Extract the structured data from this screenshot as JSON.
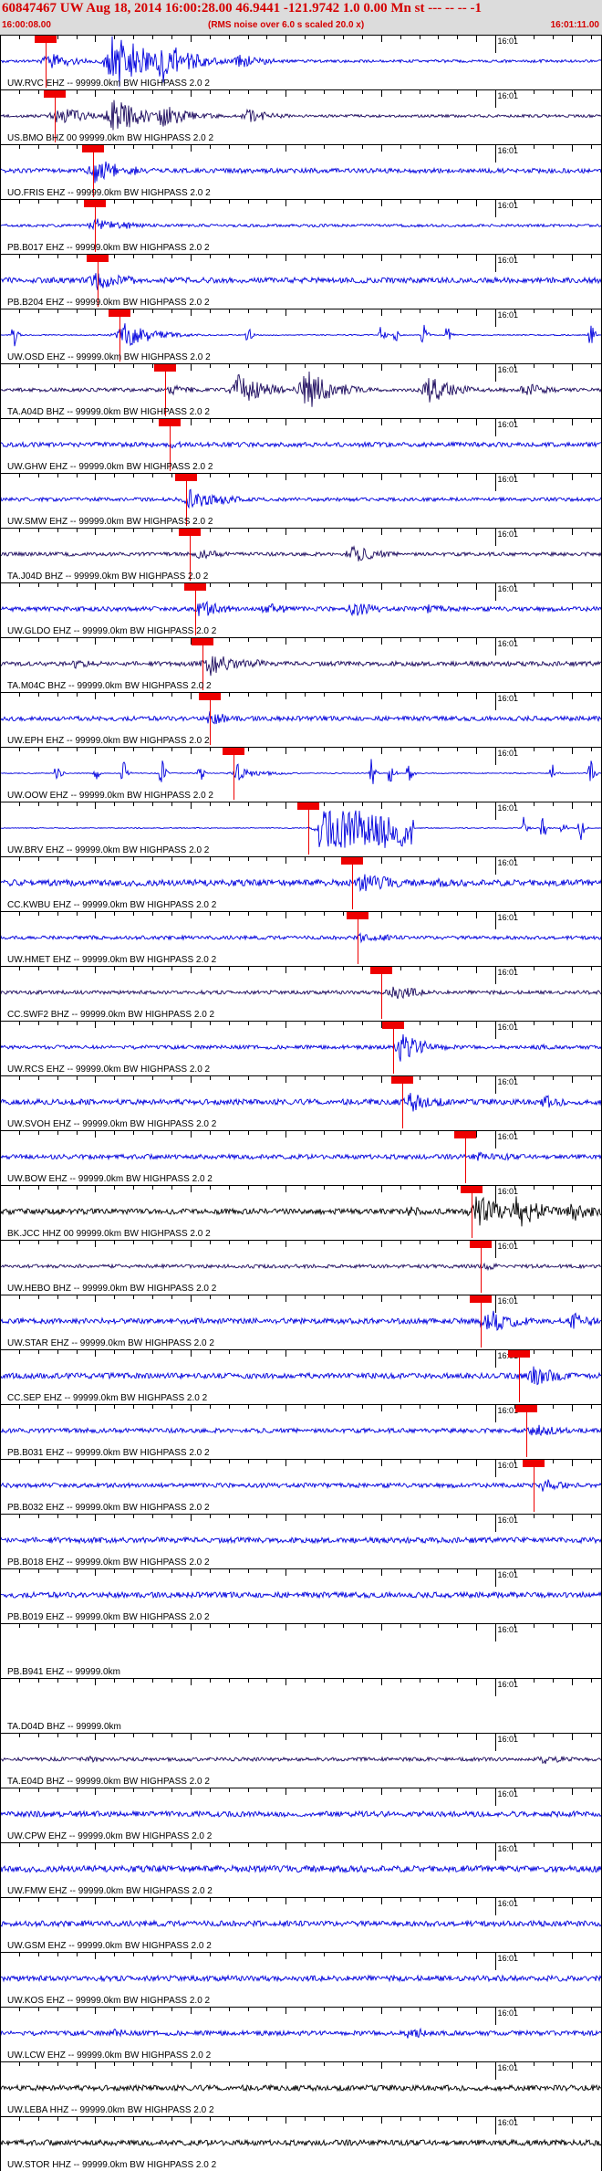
{
  "header": {
    "title": "60847467 UW Aug 18, 2014 16:00:28.00   46.9441 -121.9742  1.0 0.00 Mn st --- -- --  -1",
    "start_time": "16:00:08.00",
    "rms_note": "(RMS noise over 6.0 s scaled 20.0 x)",
    "end_time": "16:01:11.00"
  },
  "minute_tick_label": "16:01",
  "colors": {
    "blue": "#0000dd",
    "navy": "#1c0a5e",
    "black": "#000000",
    "pick": "#ee0000",
    "grid": "#000000"
  },
  "chart_data": {
    "type": "line",
    "title": "60847467 UW Aug 18, 2014 16:00:28.00",
    "x_range_s": [
      0,
      63
    ],
    "minute_mark_s": 52,
    "traces": [
      {
        "label": "UW.RVC EHZ -- 99999.0km BW  HIGHPASS  2.0  2",
        "color": "blue",
        "pick_s": 4.8,
        "env": [
          [
            5,
            10
          ],
          [
            12,
            40
          ],
          [
            17,
            26
          ],
          [
            25,
            9
          ]
        ],
        "noise": 1.5
      },
      {
        "label": "US.BMO BHZ 00 99999.0km BW  HIGHPASS  2.0  2",
        "color": "navy",
        "pick_s": 5.7,
        "env": [
          [
            6,
            12
          ],
          [
            12,
            22
          ],
          [
            17,
            14
          ],
          [
            26,
            8
          ]
        ],
        "noise": 1.5
      },
      {
        "label": "UO.FRIS EHZ -- 99999.0km BW  HIGHPASS  2.0  2",
        "color": "blue",
        "pick_s": 9.8,
        "env": [
          [
            10,
            15
          ],
          [
            11,
            8
          ],
          [
            14,
            5
          ]
        ],
        "noise": 2.5
      },
      {
        "label": "PB.B017 EHZ -- 99999.0km BW  HIGHPASS  2.0  2",
        "color": "blue",
        "pick_s": 10.0,
        "env": [
          [
            10,
            8
          ],
          [
            13,
            4
          ]
        ],
        "noise": 1.5
      },
      {
        "label": "PB.B204 EHZ -- 99999.0km BW  HIGHPASS  2.0  2",
        "color": "blue",
        "pick_s": 10.2,
        "env": [
          [
            10,
            12
          ],
          [
            13,
            6
          ]
        ],
        "noise": 3
      },
      {
        "label": "UW.OSD EHZ -- 99999.0km BW  HIGHPASS  2.0  2",
        "color": "blue",
        "pick_s": 12.5,
        "env": [
          [
            13,
            14
          ],
          [
            15,
            8
          ]
        ],
        "noise": 0.6,
        "spikes": [
          [
            1.5,
            16
          ],
          [
            14,
            15
          ],
          [
            26,
            14
          ],
          [
            40,
            12
          ],
          [
            41.5,
            10
          ],
          [
            44.5,
            14
          ],
          [
            47,
            16
          ],
          [
            62,
            18
          ]
        ]
      },
      {
        "label": "TA.A04D BHZ -- 99999.0km BW  HIGHPASS  2.0  2",
        "color": "navy",
        "pick_s": 17.3,
        "env": [
          [
            18,
            6
          ],
          [
            25,
            18
          ],
          [
            32,
            24
          ],
          [
            45,
            16
          ],
          [
            55,
            8
          ]
        ],
        "noise": 2
      },
      {
        "label": "UW.GHW EHZ -- 99999.0km BW  HIGHPASS  2.0  2",
        "color": "blue",
        "pick_s": 17.8,
        "env": [
          [
            18,
            4
          ],
          [
            21,
            2
          ]
        ],
        "noise": 2.5
      },
      {
        "label": "UW.SMW EHZ -- 99999.0km BW  HIGHPASS  2.0  2",
        "color": "blue",
        "pick_s": 19.5,
        "env": [
          [
            20,
            12
          ],
          [
            23,
            6
          ]
        ],
        "noise": 2
      },
      {
        "label": "TA.J04D BHZ -- 99999.0km BW  HIGHPASS  2.0  2",
        "color": "navy",
        "pick_s": 19.9,
        "env": [
          [
            21,
            6
          ],
          [
            37,
            10
          ],
          [
            40,
            4
          ]
        ],
        "noise": 2
      },
      {
        "label": "UW.GLDO EHZ -- 99999.0km BW  HIGHPASS  2.0  2",
        "color": "blue",
        "pick_s": 20.5,
        "env": [
          [
            21,
            10
          ],
          [
            28,
            8
          ],
          [
            37,
            9
          ],
          [
            45,
            6
          ]
        ],
        "noise": 2.5
      },
      {
        "label": "TA.M04C BHZ -- 99999.0km BW  HIGHPASS  2.0  2",
        "color": "navy",
        "pick_s": 21.3,
        "env": [
          [
            8,
            6
          ],
          [
            22,
            14
          ],
          [
            26,
            6
          ]
        ],
        "noise": 2.5
      },
      {
        "label": "UW.EPH EHZ -- 99999.0km BW  HIGHPASS  2.0  2",
        "color": "blue",
        "pick_s": 22.0,
        "env": [
          [
            22,
            8
          ]
        ],
        "noise": 2.5
      },
      {
        "label": "UW.OOW EHZ -- 99999.0km BW  HIGHPASS  2.0  2",
        "color": "blue",
        "pick_s": 24.5,
        "env": [
          [
            25,
            6
          ]
        ],
        "noise": 0.5,
        "spikes": [
          [
            6,
            14
          ],
          [
            10,
            12
          ],
          [
            13,
            15
          ],
          [
            17,
            16
          ],
          [
            21,
            14
          ],
          [
            25,
            16
          ],
          [
            39,
            20
          ],
          [
            41,
            18
          ],
          [
            43,
            16
          ],
          [
            58,
            12
          ],
          [
            62,
            17
          ]
        ]
      },
      {
        "label": "UW.BRV EHZ -- 99999.0km BW  HIGHPASS  2.0  2",
        "color": "blue",
        "pick_s": 32.4,
        "env": [
          [
            34,
            16
          ]
        ],
        "noise": 0.5,
        "spikes": [
          [
            55,
            14
          ],
          [
            57,
            16
          ],
          [
            59,
            12
          ],
          [
            61,
            14
          ]
        ],
        "burst": [
          33.5,
          43.5
        ]
      },
      {
        "label": "CC.KWBU EHZ -- 99999.0km BW  HIGHPASS  2.0  2",
        "color": "blue",
        "pick_s": 37.0,
        "env": [
          [
            38,
            12
          ],
          [
            40,
            8
          ],
          [
            46,
            5
          ]
        ],
        "noise": 3.5
      },
      {
        "label": "UW.HMET EHZ -- 99999.0km BW  HIGHPASS  2.0  2",
        "color": "blue",
        "pick_s": 37.5,
        "env": [
          [
            38,
            6
          ],
          [
            40,
            4
          ]
        ],
        "noise": 2
      },
      {
        "label": "CC.SWF2 BHZ -- 99999.0km BW  HIGHPASS  2.0  2",
        "color": "navy",
        "pick_s": 40.0,
        "env": [
          [
            41,
            10
          ],
          [
            43,
            5
          ]
        ],
        "noise": 2
      },
      {
        "label": "UW.RCS EHZ -- 99999.0km BW  HIGHPASS  2.0  2",
        "color": "blue",
        "pick_s": 41.3,
        "env": [
          [
            42,
            16
          ],
          [
            44,
            6
          ],
          [
            56,
            4
          ]
        ],
        "noise": 2
      },
      {
        "label": "UW.SVOH EHZ -- 99999.0km BW  HIGHPASS  2.0  2",
        "color": "blue",
        "pick_s": 42.2,
        "env": [
          [
            43,
            12
          ],
          [
            46,
            5
          ],
          [
            57,
            8
          ]
        ],
        "noise": 3
      },
      {
        "label": "UW.BOW EHZ -- 99999.0km BW  HIGHPASS  2.0  2",
        "color": "blue",
        "pick_s": 48.8,
        "env": [
          [
            50,
            6
          ],
          [
            53,
            4
          ]
        ],
        "noise": 2.5
      },
      {
        "label": "BK.JCC HHZ 00 99999.0km BW  HIGHPASS  2.0  2",
        "color": "black",
        "pick_s": 49.5,
        "env": [
          [
            43,
            6
          ],
          [
            50,
            20
          ],
          [
            54,
            22
          ],
          [
            60,
            12
          ]
        ],
        "noise": 3
      },
      {
        "label": "UW.HEBO BHZ -- 99999.0km BW  HIGHPASS  2.0  2",
        "color": "navy",
        "pick_s": 50.5,
        "env": [
          [
            51,
            4
          ]
        ],
        "noise": 2
      },
      {
        "label": "UW.STAR EHZ -- 99999.0km BW  HIGHPASS  2.0  2",
        "color": "blue",
        "pick_s": 50.5,
        "env": [
          [
            51,
            16
          ],
          [
            54,
            6
          ],
          [
            60,
            10
          ]
        ],
        "noise": 3
      },
      {
        "label": "CC.SEP EHZ -- 99999.0km BW  HIGHPASS  2.0  2",
        "color": "blue",
        "pick_s": 54.5,
        "env": [
          [
            56,
            12
          ],
          [
            58,
            6
          ]
        ],
        "noise": 3
      },
      {
        "label": "PB.B031 EHZ -- 99999.0km BW  HIGHPASS  2.0  2",
        "color": "blue",
        "pick_s": 55.2,
        "env": [
          [
            56,
            8
          ],
          [
            58,
            5
          ]
        ],
        "noise": 2.5
      },
      {
        "label": "PB.B032 EHZ -- 99999.0km BW  HIGHPASS  2.0  2",
        "color": "blue",
        "pick_s": 56.0,
        "env": [
          [
            57,
            8
          ]
        ],
        "noise": 2.5
      },
      {
        "label": "PB.B018 EHZ -- 99999.0km BW  HIGHPASS  2.0  2",
        "color": "blue",
        "noise": 3
      },
      {
        "label": "PB.B019 EHZ -- 99999.0km BW  HIGHPASS  2.0  2",
        "color": "blue",
        "noise": 3
      },
      {
        "label": "PB.B941 EHZ -- 99999.0km",
        "color": "blue",
        "noise": 0
      },
      {
        "label": "TA.D04D BHZ -- 99999.0km",
        "color": "navy",
        "noise": 0
      },
      {
        "label": "TA.E04D BHZ -- 99999.0km BW  HIGHPASS  2.0  2",
        "color": "navy",
        "noise": 2,
        "env": [
          [
            9,
            4
          ],
          [
            57,
            6
          ]
        ]
      },
      {
        "label": "UW.CPW EHZ -- 99999.0km BW  HIGHPASS  2.0  2",
        "color": "blue",
        "noise": 3
      },
      {
        "label": "UW.FMW EHZ -- 99999.0km BW  HIGHPASS  2.0  2",
        "color": "blue",
        "noise": 3.5
      },
      {
        "label": "UW.GSM EHZ -- 99999.0km BW  HIGHPASS  2.0  2",
        "color": "blue",
        "noise": 3
      },
      {
        "label": "UW.KOS EHZ -- 99999.0km BW  HIGHPASS  2.0  2",
        "color": "blue",
        "noise": 3
      },
      {
        "label": "UW.LCW EHZ -- 99999.0km BW  HIGHPASS  2.0  2",
        "color": "blue",
        "noise": 2.5,
        "env": [
          [
            12,
            5
          ],
          [
            43,
            8
          ]
        ]
      },
      {
        "label": "UW.LEBA HHZ -- 99999.0km BW  HIGHPASS  2.0  2",
        "color": "black",
        "noise": 3
      },
      {
        "label": "UW.STOR HHZ -- 99999.0km BW  HIGHPASS  2.0  2",
        "color": "black",
        "noise": 3
      }
    ]
  }
}
